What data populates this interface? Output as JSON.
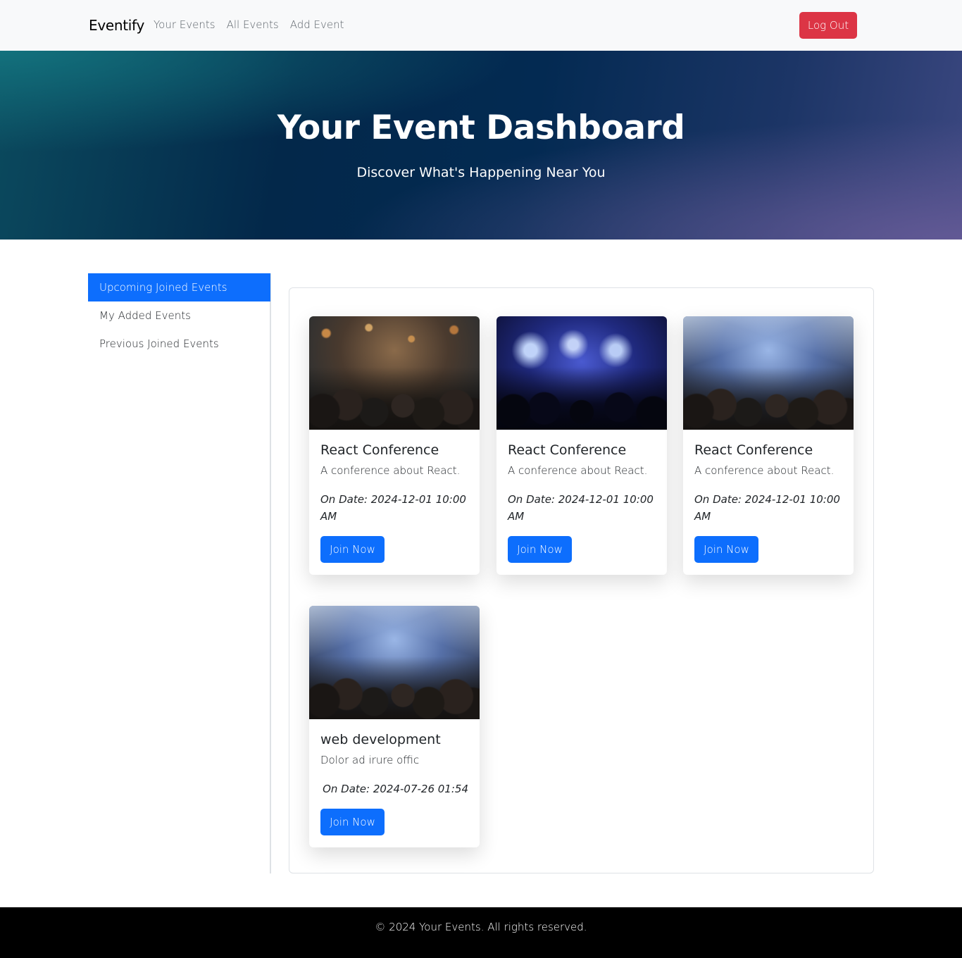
{
  "navbar": {
    "brand": "Eventify",
    "links": [
      "Your Events",
      "All Events",
      "Add Event"
    ],
    "logout_label": "Log Out"
  },
  "hero": {
    "title": "Your Event Dashboard",
    "subtitle": "Discover What's Happening Near You"
  },
  "sidebar": {
    "items": [
      {
        "label": "Upcoming Joined Events",
        "active": true
      },
      {
        "label": "My Added Events",
        "active": false
      },
      {
        "label": "Previous Joined Events",
        "active": false
      }
    ]
  },
  "events": [
    {
      "title": "React Conference",
      "description": "A conference about React.",
      "date": "On Date: 2024-12-01 10:00 AM",
      "button": "Join Now"
    },
    {
      "title": "React Conference",
      "description": "A conference about React.",
      "date": "On Date: 2024-12-01 10:00 AM",
      "button": "Join Now"
    },
    {
      "title": "React Conference",
      "description": "A conference about React.",
      "date": "On Date: 2024-12-01 10:00 AM",
      "button": "Join Now"
    },
    {
      "title": "web development",
      "description": "Dolor ad irure offic",
      "date": "On Date: 2024-07-26 01:54",
      "button": "Join Now"
    }
  ],
  "footer": {
    "text": "© 2024 Your Events. All rights reserved."
  },
  "colors": {
    "primary": "#0d6efd",
    "danger": "#dc3545",
    "footer_bg": "#000000",
    "navbar_bg": "#f8f9fa"
  }
}
